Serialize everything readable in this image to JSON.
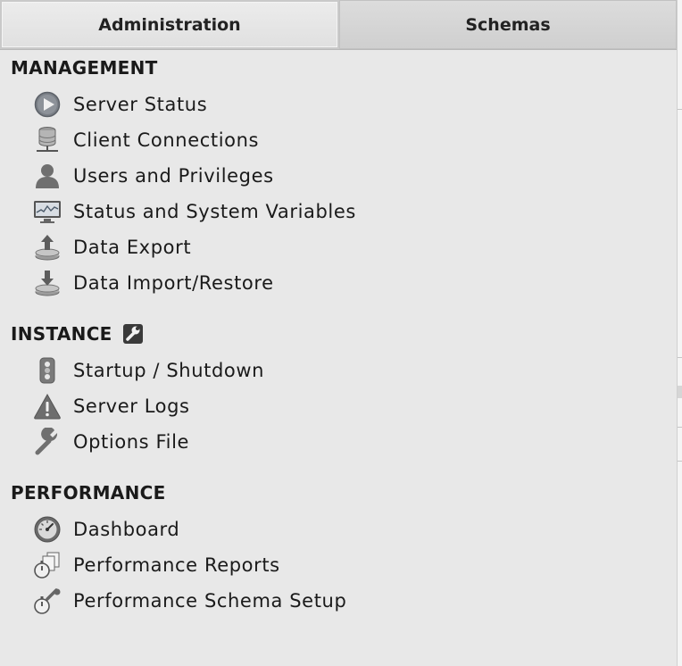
{
  "tabs": [
    {
      "label": "Administration",
      "active": true
    },
    {
      "label": "Schemas",
      "active": false
    }
  ],
  "sections": {
    "management": {
      "title": "MANAGEMENT",
      "items": [
        {
          "label": "Server Status",
          "icon": "play-circle-icon"
        },
        {
          "label": "Client Connections",
          "icon": "database-network-icon"
        },
        {
          "label": "Users and Privileges",
          "icon": "user-icon"
        },
        {
          "label": "Status and System Variables",
          "icon": "monitor-chart-icon"
        },
        {
          "label": "Data Export",
          "icon": "upload-disk-icon"
        },
        {
          "label": "Data Import/Restore",
          "icon": "download-disk-icon"
        }
      ]
    },
    "instance": {
      "title": "INSTANCE",
      "items": [
        {
          "label": "Startup / Shutdown",
          "icon": "traffic-light-icon"
        },
        {
          "label": "Server Logs",
          "icon": "warning-icon"
        },
        {
          "label": "Options File",
          "icon": "wrench-icon"
        }
      ]
    },
    "performance": {
      "title": "PERFORMANCE",
      "items": [
        {
          "label": "Dashboard",
          "icon": "gauge-icon"
        },
        {
          "label": "Performance Reports",
          "icon": "stopwatch-report-icon"
        },
        {
          "label": "Performance Schema Setup",
          "icon": "stopwatch-wrench-icon"
        }
      ]
    }
  }
}
